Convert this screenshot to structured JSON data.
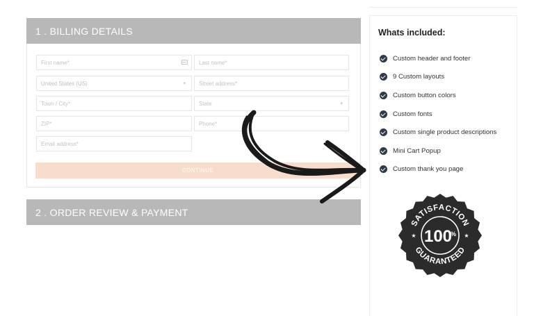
{
  "billing": {
    "header": "1 . BILLING DETAILS",
    "fields": {
      "first_name": "First name*",
      "last_name": "Last name*",
      "country": "United States (US)",
      "street": "Street address*",
      "city": "Town / City*",
      "state": "State",
      "zip": "ZIP*",
      "phone": "Phone*",
      "email": "Email address*"
    },
    "continue_label": "CONTINUE"
  },
  "order": {
    "header": "2 . ORDER REVIEW & PAYMENT"
  },
  "sidebar": {
    "title": "Whats included:",
    "items": [
      "Custom header and footer",
      "9 Custom layouts",
      "Custom button colors",
      "Custom fonts",
      "Custom single product descriptions",
      "Mini Cart Popup",
      "Custom thank you page"
    ]
  },
  "badge": {
    "top_text": "SATISFACTION",
    "center_text": "100",
    "percent": "%",
    "bottom_text": "GUARANTEED"
  },
  "icons": {
    "check": "check-circle-icon",
    "card": "contact-card-icon",
    "dropdown": "chevron-down-icon",
    "arrow": "hand-drawn-arrow-icon"
  },
  "colors": {
    "header_bg": "#b8b8b8",
    "button_bg": "#f8ddcc",
    "check": "#2f3b4a",
    "badge": "#2b2b2b"
  }
}
